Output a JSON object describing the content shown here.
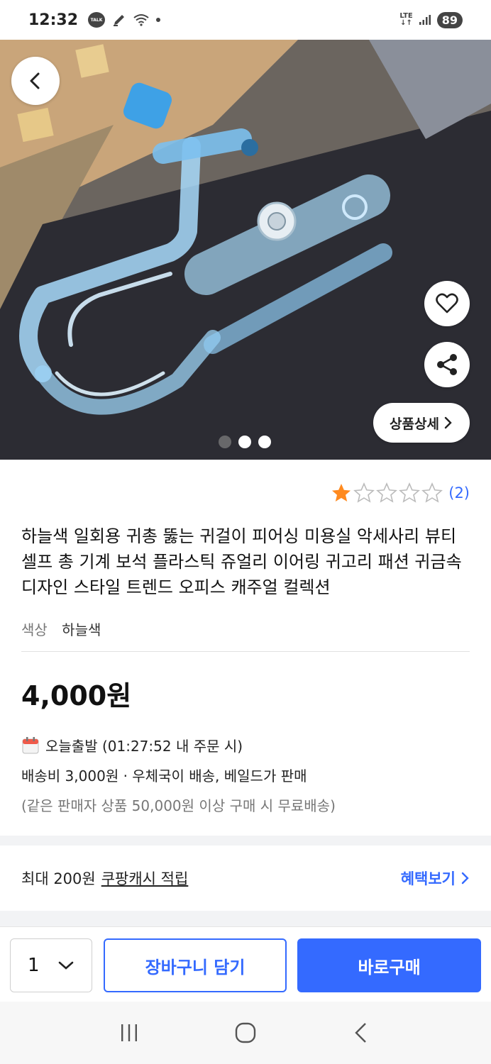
{
  "status_bar": {
    "time": "12:32",
    "talk_icon_text": "TALK",
    "lte_top": "LTE",
    "lte_bottom": "↓↑",
    "battery": "89"
  },
  "hero": {
    "detail_button_label": "상품상세",
    "dots_total": 3,
    "dots_active_index": 0
  },
  "rating": {
    "stars_filled": 1,
    "stars_total": 5,
    "count": "(2)",
    "star_color": "#ff8a1f"
  },
  "product": {
    "title": "하늘색 일회용 귀총 뚫는 귀걸이 피어싱 미용실 악세사리 뷰티 셀프 총 기계 보석 플라스틱 쥬얼리 이어링 귀고리 패션 귀금속 디자인 스타일 트렌드 오피스 캐주얼 컬렉션",
    "color_label": "색상",
    "color_value": "하늘색",
    "price": "4,000원"
  },
  "shipping": {
    "today_ship": "오늘출발 (01:27:52 내 주문 시)",
    "fee": "배송비 3,000원 · 우체국이 배송, 베일드가 판매",
    "free_note": "(같은 판매자 상품 50,000원 이상 구매 시 무료배송)"
  },
  "cash": {
    "prefix": "최대 200원",
    "link": "쿠팡캐시 적립",
    "benefit": "혜택보기"
  },
  "bottom": {
    "quantity": "1",
    "cart_label": "장바구니 담기",
    "buy_label": "바로구매"
  },
  "colors": {
    "accent": "#346aff"
  }
}
